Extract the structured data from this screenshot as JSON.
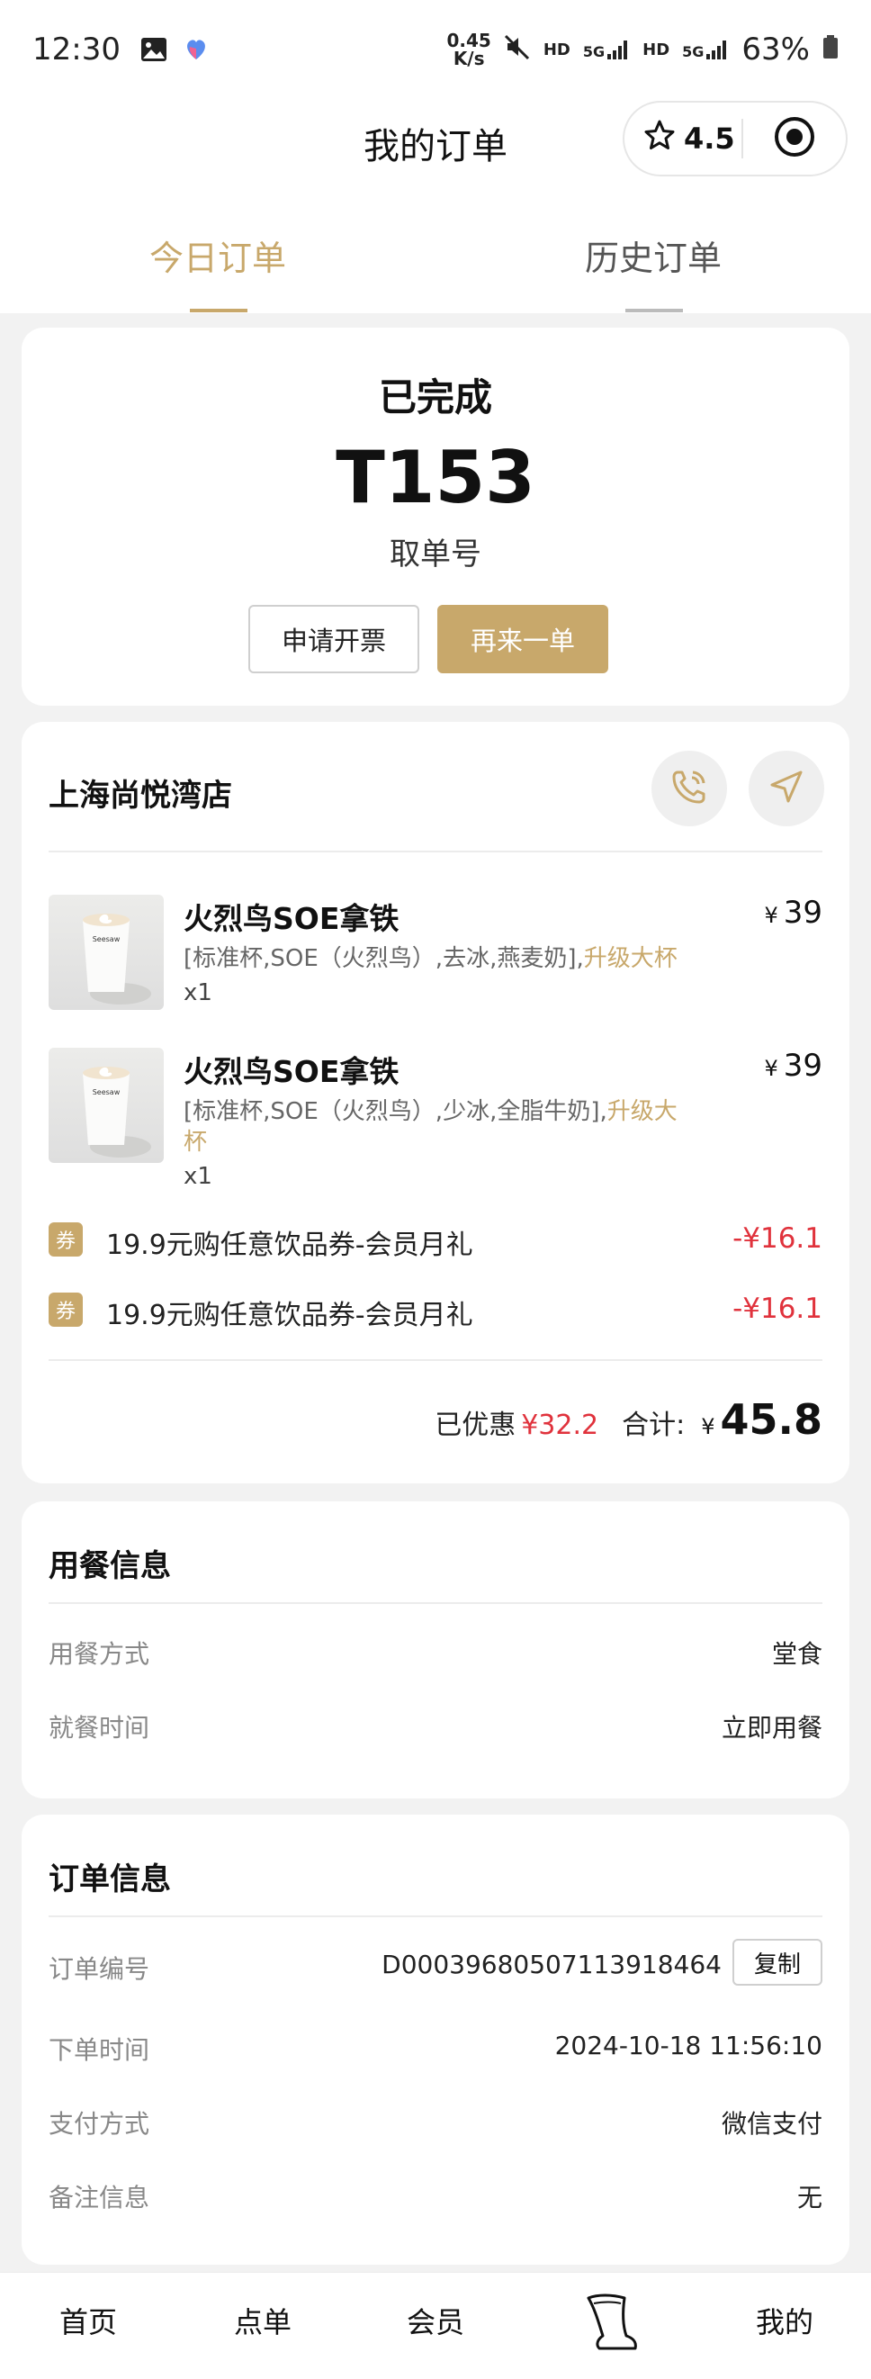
{
  "status_bar": {
    "time": "12:30",
    "net_speed_value": "0.45",
    "net_speed_unit": "K/s",
    "hd1": "HD",
    "hd2": "HD",
    "sig1": "5G",
    "sig2": "5G",
    "battery": "63%"
  },
  "header": {
    "title": "我的订单",
    "rating": "4.5"
  },
  "tabs": [
    {
      "label": "今日订单",
      "active": true
    },
    {
      "label": "历史订单",
      "active": false
    }
  ],
  "order_status": {
    "status": "已完成",
    "pickup_number": "T153",
    "pickup_label": "取单号",
    "invoice_button": "申请开票",
    "reorder_button": "再来一单"
  },
  "store": {
    "name": "上海尚悦湾店"
  },
  "items": [
    {
      "name": "火烈鸟SOE拿铁",
      "spec": "[标准杯,SOE（火烈鸟）,去冰,燕麦奶],",
      "upgrade": "升级大杯",
      "qty": "x1",
      "currency": "¥",
      "price": "39"
    },
    {
      "name": "火烈鸟SOE拿铁",
      "spec": "[标准杯,SOE（火烈鸟）,少冰,全脂牛奶],",
      "upgrade": "升级大杯",
      "qty": "x1",
      "currency": "¥",
      "price": "39"
    }
  ],
  "coupons": [
    {
      "badge": "券",
      "text": "19.9元购任意饮品券-会员月礼",
      "amount": "-¥16.1"
    },
    {
      "badge": "券",
      "text": "19.9元购任意饮品券-会员月礼",
      "amount": "-¥16.1"
    }
  ],
  "summary": {
    "discount_label": "已优惠",
    "discount_value": "¥32.2",
    "total_label": "合计:",
    "currency": "¥",
    "total": "45.8"
  },
  "dining": {
    "title": "用餐信息",
    "rows": [
      {
        "key": "用餐方式",
        "value": "堂食"
      },
      {
        "key": "就餐时间",
        "value": "立即用餐"
      }
    ]
  },
  "order_info": {
    "title": "订单信息",
    "order_no_label": "订单编号",
    "order_no": "D0003968050711391846­4",
    "copy_button": "复制",
    "rows": [
      {
        "key": "下单时间",
        "value": "2024-10-18 11:56:10"
      },
      {
        "key": "支付方式",
        "value": "微信支付"
      },
      {
        "key": "备注信息",
        "value": "无"
      }
    ]
  },
  "bottom_nav": {
    "home": "首页",
    "order": "点单",
    "member": "会员",
    "mine": "我的"
  },
  "colors": {
    "accent": "#c8a86b",
    "discount_red": "#e0323c"
  }
}
